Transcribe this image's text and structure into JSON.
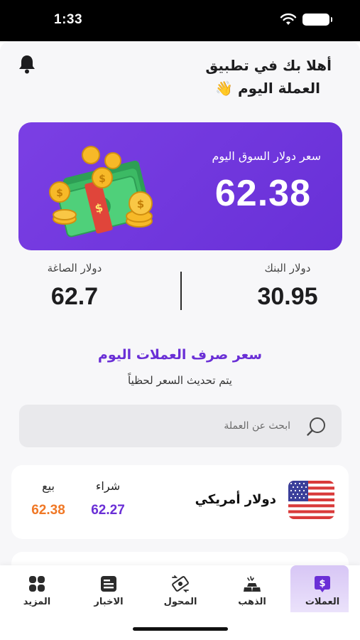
{
  "status_bar": {
    "time": "1:33"
  },
  "header": {
    "greeting_line1": "أهلا بك في تطبيق",
    "greeting_line2": "العملة اليوم 👋"
  },
  "hero": {
    "title": "سعر دولار السوق اليوم",
    "value": "62.38",
    "accent": "#6f35dd"
  },
  "rates": {
    "bank": {
      "label": "دولار البنك",
      "value": "30.95"
    },
    "gold": {
      "label": "دولار الصاغة",
      "value": "62.7"
    }
  },
  "exchange_section": {
    "title": "سعر صرف العملات اليوم",
    "subtitle": "يتم تحديث السعر لحظياً"
  },
  "search": {
    "placeholder": "ابحث عن العملة",
    "value": ""
  },
  "currencies": [
    {
      "name": "دولار أمريكي",
      "flag_icon": "us-flag-icon",
      "buy_label": "شراء",
      "buy_value": "62.27",
      "sell_label": "بيع",
      "sell_value": "62.38"
    }
  ],
  "colors": {
    "buy": "#6a2fd6",
    "sell": "#f07826",
    "brand": "#6a2fd6"
  },
  "tabs": [
    {
      "label": "العملات",
      "icon": "dollar-tag-icon",
      "active": true
    },
    {
      "label": "الذهب",
      "icon": "gold-bars-icon",
      "active": false
    },
    {
      "label": "المحول",
      "icon": "exchange-icon",
      "active": false
    },
    {
      "label": "الاخبار",
      "icon": "news-icon",
      "active": false
    },
    {
      "label": "المزيد",
      "icon": "grid-icon",
      "active": false
    }
  ]
}
